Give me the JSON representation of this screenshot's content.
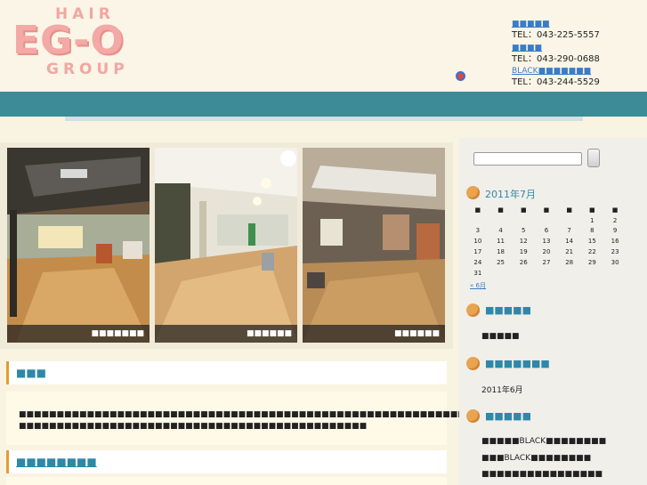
{
  "logo": {
    "hair": "HAIR",
    "main": "EG-O",
    "group": "GROUP"
  },
  "contacts": [
    {
      "name": "■■■■■",
      "tel": "TEL：043-225-5557"
    },
    {
      "name": "■■■■",
      "tel": "TEL：043-290-0688"
    },
    {
      "name": "BLACK■■■■■■■",
      "tel": "TEL：043-244-5529"
    }
  ],
  "photos": [
    {
      "caption": "■■■■■■■"
    },
    {
      "caption": "■■■■■■"
    },
    {
      "caption": "■■■■■■"
    }
  ],
  "main": {
    "section1_title": "■■■",
    "intro_line1": "■■■■■■■■■■■■■■■■■■■■■■■■■■■■■■■■■■■■■■■■■■■■■■■■■■■■■■■■■■■■■■■■■■■■■■■■■■■■■",
    "intro_line2": "■■■■■■■■■■■■■■■■■■■■■■■■■■■■■■■■■■■■■■■■■■■■■■",
    "section2_title": "■■■■■■■■"
  },
  "sidebar": {
    "calendar_title": "2011年7月",
    "weekdays": [
      "■",
      "■",
      "■",
      "■",
      "■",
      "■",
      "■"
    ],
    "weeks": [
      [
        "",
        "",
        "",
        "",
        "",
        "1",
        "2"
      ],
      [
        "3",
        "4",
        "5",
        "6",
        "7",
        "8",
        "9"
      ],
      [
        "10",
        "11",
        "12",
        "13",
        "14",
        "15",
        "16"
      ],
      [
        "17",
        "18",
        "19",
        "20",
        "21",
        "22",
        "23"
      ],
      [
        "24",
        "25",
        "26",
        "27",
        "28",
        "29",
        "30"
      ],
      [
        "31",
        "",
        "",
        "",
        "",
        "",
        ""
      ]
    ],
    "prev_link": "« 6月",
    "cat_title": "■■■■■",
    "cat_item": "■■■■■",
    "archive_title": "■■■■■■■",
    "archive_item": "2011年6月",
    "recent_title": "■■■■■",
    "recent_items": [
      "■■■■■BLACK■■■■■■■■",
      "■■■BLACK■■■■■■■■",
      "■■■■■■■■■■■■■■■■"
    ]
  },
  "colors": {
    "nav": "#3e8b98",
    "accent": "#e49b2f",
    "link": "#2f88a8",
    "logo": "#f3a9a5"
  }
}
